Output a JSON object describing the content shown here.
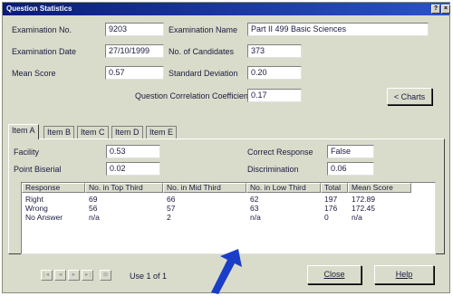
{
  "window": {
    "title": "Question Statistics",
    "help_button": "?",
    "close_button": "×"
  },
  "fields": {
    "exam_no_label": "Examination No.",
    "exam_no_value": "9203",
    "exam_name_label": "Examination Name",
    "exam_name_value": "Part II 499 Basic Sciences",
    "exam_date_label": "Examination Date",
    "exam_date_value": "27/10/1999",
    "candidates_label": "No. of Candidates",
    "candidates_value": "373",
    "mean_label": "Mean Score",
    "mean_value": "0.57",
    "sd_label": "Standard Deviation",
    "sd_value": "0.20",
    "qcc_label": "Question Correlation Coefficient",
    "qcc_value": "0.17"
  },
  "charts_button": "< Charts",
  "tabs": [
    "Item A",
    "Item B",
    "Item C",
    "Item D",
    "Item E"
  ],
  "item": {
    "facility_label": "Facility",
    "facility_value": "0.53",
    "biserial_label": "Point Biserial",
    "biserial_value": "0.02",
    "correct_label": "Correct Response",
    "correct_value": "False",
    "discrim_label": "Discrimination",
    "discrim_value": "0.06"
  },
  "table": {
    "headers": [
      "Response",
      "No. in Top Third",
      "No. in Mid Third",
      "No. in Low Third",
      "Total",
      "Mean Score"
    ],
    "rows": [
      [
        "Right",
        "69",
        "66",
        "62",
        "197",
        "172.89"
      ],
      [
        "Wrong",
        "56",
        "57",
        "63",
        "176",
        "172.45"
      ],
      [
        "No Answer",
        "n/a",
        "2",
        "n/a",
        "0",
        "n/a"
      ]
    ]
  },
  "footer": {
    "nav_first": "|◄",
    "nav_prev": "◄",
    "nav_next": "►",
    "nav_last": "►|",
    "nav_jump": "⊠",
    "record_label": "Use 1 of 1",
    "close_button": "Close",
    "help_button": "Help"
  },
  "colors": {
    "titlebar": "#0a1b7a",
    "window_bg": "#d9dcca",
    "annotation_arrow": "#1a3ec8"
  }
}
